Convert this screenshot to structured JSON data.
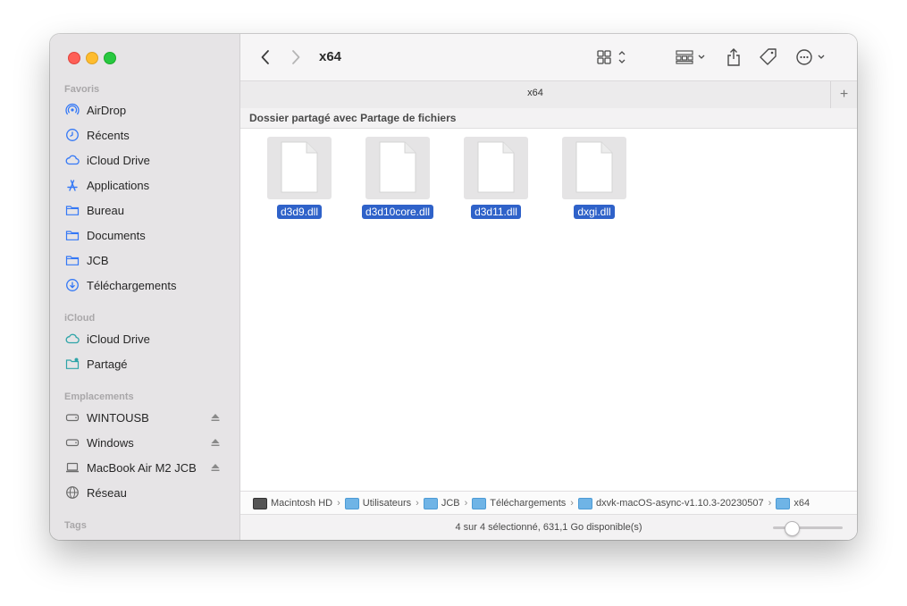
{
  "sidebar": {
    "favorites_title": "Favoris",
    "favorites": [
      {
        "label": "AirDrop",
        "icon": "airdrop-icon"
      },
      {
        "label": "Récents",
        "icon": "clock-icon"
      },
      {
        "label": "iCloud Drive",
        "icon": "cloud-icon"
      },
      {
        "label": "Applications",
        "icon": "applications-icon"
      },
      {
        "label": "Bureau",
        "icon": "folder-icon"
      },
      {
        "label": "Documents",
        "icon": "folder-icon"
      },
      {
        "label": "JCB",
        "icon": "folder-icon"
      },
      {
        "label": "Téléchargements",
        "icon": "download-icon"
      }
    ],
    "icloud_title": "iCloud",
    "icloud": [
      {
        "label": "iCloud Drive",
        "icon": "cloud-icon"
      },
      {
        "label": "Partagé",
        "icon": "shared-folder-icon"
      }
    ],
    "locations_title": "Emplacements",
    "locations": [
      {
        "label": "WINTOUSB",
        "icon": "drive-icon",
        "eject": true
      },
      {
        "label": "Windows",
        "icon": "drive-icon",
        "eject": true
      },
      {
        "label": "MacBook Air M2 JCB",
        "icon": "laptop-icon",
        "eject": true
      },
      {
        "label": "Réseau",
        "icon": "network-icon",
        "eject": false
      }
    ],
    "tags_title": "Tags"
  },
  "toolbar": {
    "title": "x64"
  },
  "tab": {
    "label": "x64",
    "plus": "+"
  },
  "shared_banner": "Dossier partagé avec Partage de fichiers",
  "files": [
    {
      "name": "d3d9.dll",
      "selected": true
    },
    {
      "name": "d3d10core.dll",
      "selected": true
    },
    {
      "name": "d3d11.dll",
      "selected": true
    },
    {
      "name": "dxgi.dll",
      "selected": true
    }
  ],
  "pathbar": [
    {
      "label": "Macintosh HD",
      "icon": "hard-drive-icon"
    },
    {
      "label": "Utilisateurs",
      "icon": "folder-icon"
    },
    {
      "label": "JCB",
      "icon": "folder-icon"
    },
    {
      "label": "Téléchargements",
      "icon": "folder-icon"
    },
    {
      "label": "dxvk-macOS-async-v1.10.3-20230507",
      "icon": "folder-icon"
    },
    {
      "label": "x64",
      "icon": "folder-icon"
    }
  ],
  "status": {
    "text": "4 sur 4 sélectionné, 631,1 Go disponible(s)",
    "zoom_level": 0.2
  },
  "colors": {
    "accent": "#2f62c9",
    "sidebar_icon": "#3478f6"
  }
}
